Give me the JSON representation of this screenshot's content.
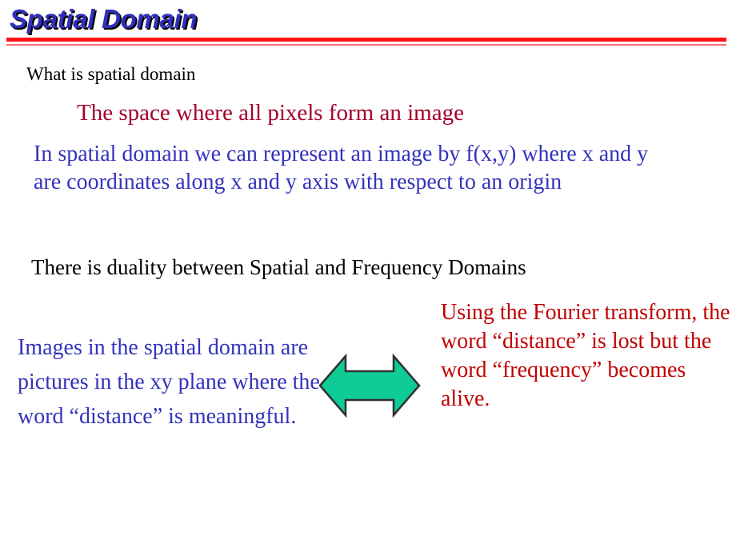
{
  "slide": {
    "title": "Spatial Domain",
    "title_color": "#2f2fb9",
    "rule_color_thick": "#ff1111",
    "rule_color_thin": "#ff6a6a",
    "background": "#ffffff"
  },
  "body": {
    "heading_question": "What is spatial domain",
    "definition": "The space where all pixels form an image",
    "definition_color": "#a4002a",
    "representation": "In spatial domain we can represent an image by f(x,y) where x and y are coordinates along x and y axis with respect to an origin",
    "representation_color": "#3333bb",
    "duality_statement": "There is duality between Spatial and Frequency Domains"
  },
  "comparison": {
    "left": {
      "text": "Images in the spatial domain are pictures in the xy plane where the word “distance” is meaningful.",
      "color": "#3333bb"
    },
    "right": {
      "text": "Using the Fourier transform, the word “distance” is lost but the word “frequency” becomes alive.",
      "color": "#c00000"
    },
    "connector": {
      "icon": "double-headed-arrow-icon",
      "fill": "#0fcb95",
      "stroke": "#303030"
    }
  }
}
